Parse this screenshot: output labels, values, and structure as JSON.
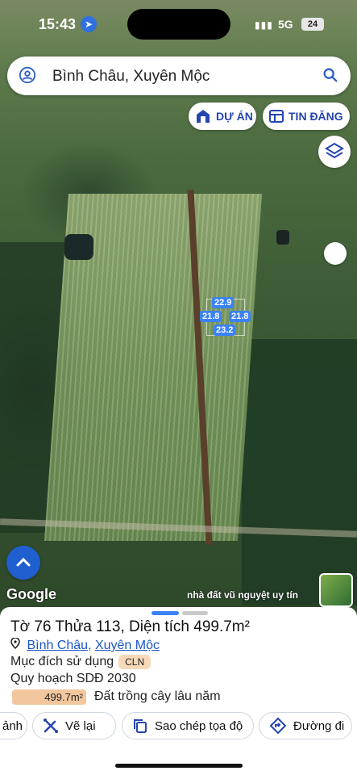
{
  "status_bar": {
    "time": "15:43",
    "network": "5G",
    "battery": "24"
  },
  "search": {
    "value": "Bình Châu, Xuyên Mộc"
  },
  "map_buttons": {
    "du_an": "DỰ ÁN",
    "tin_dang": "TIN ĐĂNG"
  },
  "measurements": {
    "top": "22.9",
    "left": "21.8",
    "right": "21.8",
    "bottom": "23.2"
  },
  "map_footer": {
    "google": "Google",
    "credit": "nhà đất vũ nguyệt uy tín"
  },
  "parcel": {
    "title": "Tờ 76 Thửa 113, Diện tích 499.7m²",
    "ward": "Bình Châu",
    "separator": ", ",
    "district": "Xuyên Mộc",
    "purpose_label": "Mục đích sử dụng",
    "purpose_code": "CLN",
    "plan_label": "Quy hoạch SDĐ 2030",
    "plan_area": "499.7m²",
    "plan_type": "Đất trồng cây lâu năm"
  },
  "actions": {
    "partial": "ảnh",
    "redraw": "Vẽ lại",
    "copy_coords": "Sao chép tọa độ",
    "directions": "Đường đi"
  },
  "colors": {
    "accent": "#2545b0",
    "measure": "#3b82f6",
    "badge": "#f6d9b8",
    "plan_bar": "#f3c79e",
    "handle_active": "#3b82f6",
    "handle_inactive": "#c9c9c9"
  }
}
